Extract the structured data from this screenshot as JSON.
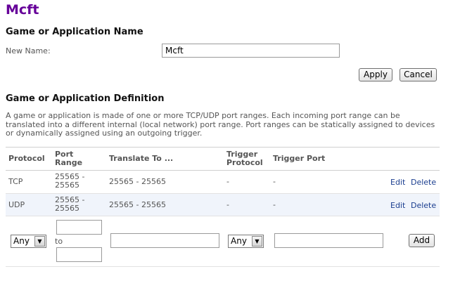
{
  "page": {
    "title": "Mcft"
  },
  "name_section": {
    "heading": "Game or Application Name",
    "label": "New Name:",
    "value": "Mcft",
    "apply_label": "Apply",
    "cancel_label": "Cancel"
  },
  "definition_section": {
    "heading": "Game or Application Definition",
    "description": "A game or application is made of one or more TCP/UDP port ranges. Each incoming port range can be translated into a different internal (local network) port range. Port ranges can be statically assigned to devices or dynamically assigned using an outgoing trigger."
  },
  "table": {
    "headers": {
      "protocol": "Protocol",
      "port_range": "Port Range",
      "translate_to": "Translate To ...",
      "trigger_protocol": "Trigger Protocol",
      "trigger_port": "Trigger Port"
    },
    "rows": [
      {
        "protocol": "TCP",
        "port_range": "25565 - 25565",
        "translate_to": "25565 - 25565",
        "trigger_protocol": "-",
        "trigger_port": "-",
        "edit_label": "Edit",
        "delete_label": "Delete"
      },
      {
        "protocol": "UDP",
        "port_range": "25565 - 25565",
        "translate_to": "25565 - 25565",
        "trigger_protocol": "-",
        "trigger_port": "-",
        "edit_label": "Edit",
        "delete_label": "Delete"
      }
    ],
    "add_row": {
      "protocol_value": "Any",
      "to_label": "to",
      "trigger_protocol_value": "Any",
      "add_label": "Add"
    }
  },
  "colors": {
    "title": "#660099",
    "link": "#1a3d8f",
    "alt_row": "#f0f4fb"
  }
}
